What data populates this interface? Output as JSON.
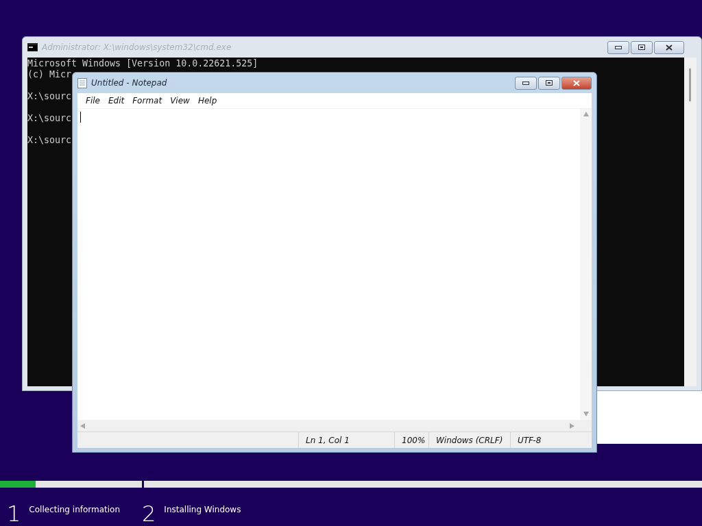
{
  "console_window": {
    "title": "Administrator: X:\\windows\\system32\\cmd.exe",
    "lines": [
      {
        "kind": "output",
        "text": "Microsoft Windows [Version 10.0.22621.525]"
      },
      {
        "kind": "output",
        "text": "(c) Micr"
      },
      {
        "kind": "prompt",
        "text": "X:\\sourc"
      },
      {
        "kind": "prompt",
        "text": "X:\\sourc"
      },
      {
        "kind": "prompt",
        "text": "X:\\sourc"
      }
    ]
  },
  "notepad_window": {
    "title": "Untitled - Notepad",
    "active": true,
    "menu": [
      "File",
      "Edit",
      "Format",
      "View",
      "Help"
    ],
    "status_bar": [
      "Ln 1, Col 1",
      "100%",
      "Windows (CRLF)",
      "UTF-8"
    ]
  },
  "setup_steps": [
    {
      "number": "1",
      "label": "Collecting information",
      "level": 0.25
    },
    {
      "number": "2",
      "label": "Installing Windows"
    }
  ]
}
